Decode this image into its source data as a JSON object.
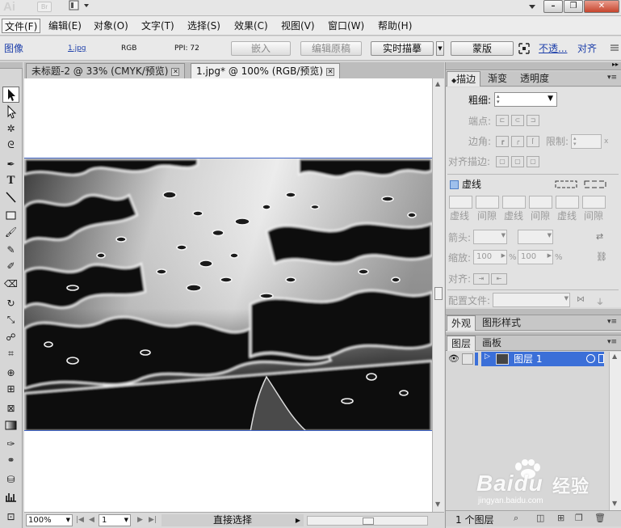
{
  "app": {
    "logo": "Ai",
    "bridge_label": "Br"
  },
  "menu": [
    "文件(F)",
    "编辑(E)",
    "对象(O)",
    "文字(T)",
    "选择(S)",
    "效果(C)",
    "视图(V)",
    "窗口(W)",
    "帮助(H)"
  ],
  "control_bar": {
    "kind": "图像",
    "filename": "1.jpg",
    "color_mode": "RGB",
    "ppi": "PPI: 72",
    "embed": "嵌入",
    "edit_original": "编辑原稿",
    "live_trace": "实时描摹",
    "mask": "蒙版",
    "opacity_label": "不透...",
    "align_label": "对齐"
  },
  "tabs": [
    {
      "label": "未标题-2 @ 33% (CMYK/预览)",
      "active": false
    },
    {
      "label": "1.jpg* @ 100% (RGB/预览)",
      "active": true
    }
  ],
  "status_bar": {
    "zoom": "100%",
    "page": "1",
    "tool_status": "直接选择"
  },
  "stroke_panel": {
    "tabs": [
      "描边",
      "渐变",
      "透明度"
    ],
    "weight_label": "粗细:",
    "cap_label": "端点:",
    "corner_label": "边角:",
    "limit_label": "限制:",
    "limit_unit": "x",
    "align_stroke_label": "对齐描边:",
    "dashed_label": "虚线",
    "dash_fields": [
      "虚线",
      "间隙",
      "虚线",
      "间隙",
      "虚线",
      "间隙"
    ],
    "arrowheads_label": "箭头:",
    "scale_label": "缩放:",
    "scale_start": "100",
    "scale_end": "100",
    "percent": "%",
    "align_label": "对齐:",
    "profile_label": "配置文件:"
  },
  "appearance_panel": {
    "tabs": [
      "外观",
      "图形样式"
    ]
  },
  "layers_panel": {
    "tabs": [
      "图层",
      "画板"
    ],
    "layers": [
      {
        "name": "图层 1"
      }
    ],
    "count": "1 个图层"
  },
  "watermark": {
    "brand": "Baidu",
    "brand_cn": "经验",
    "url": "jingyan.baidu.com"
  }
}
